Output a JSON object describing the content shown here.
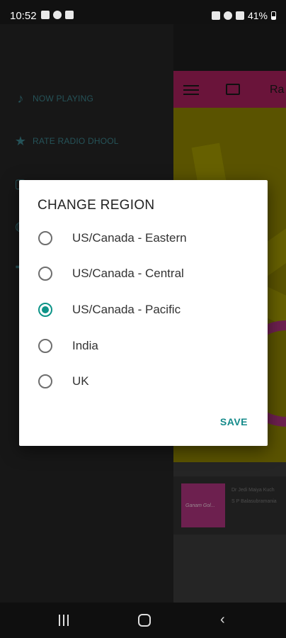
{
  "status_bar": {
    "time": "10:52",
    "battery": "41%"
  },
  "drawer": {
    "items": [
      {
        "label": "NOW PLAYING",
        "icon": "music-note-icon"
      },
      {
        "label": "RATE RADIO DHOOL",
        "icon": "star-icon"
      },
      {
        "label": "",
        "icon": "tv-icon"
      },
      {
        "label": "",
        "icon": "globe-icon"
      },
      {
        "label": "",
        "icon": "puzzle-icon"
      }
    ]
  },
  "app": {
    "toolbar_title": "Ra",
    "mini_player": {
      "thumb_label": "Ganam Gol...",
      "line1": "Dr Jedi Maiya Kuch",
      "line2": "S P Balasubramania"
    }
  },
  "dialog": {
    "title": "CHANGE REGION",
    "options": [
      {
        "label": "US/Canada - Eastern",
        "selected": false
      },
      {
        "label": "US/Canada - Central",
        "selected": false
      },
      {
        "label": "US/Canada - Pacific",
        "selected": true
      },
      {
        "label": "India",
        "selected": false
      },
      {
        "label": "UK",
        "selected": false
      }
    ],
    "save_label": "SAVE"
  },
  "colors": {
    "accent": "#0d9488",
    "toolbar": "#a4205a",
    "art": "#8a8000"
  }
}
